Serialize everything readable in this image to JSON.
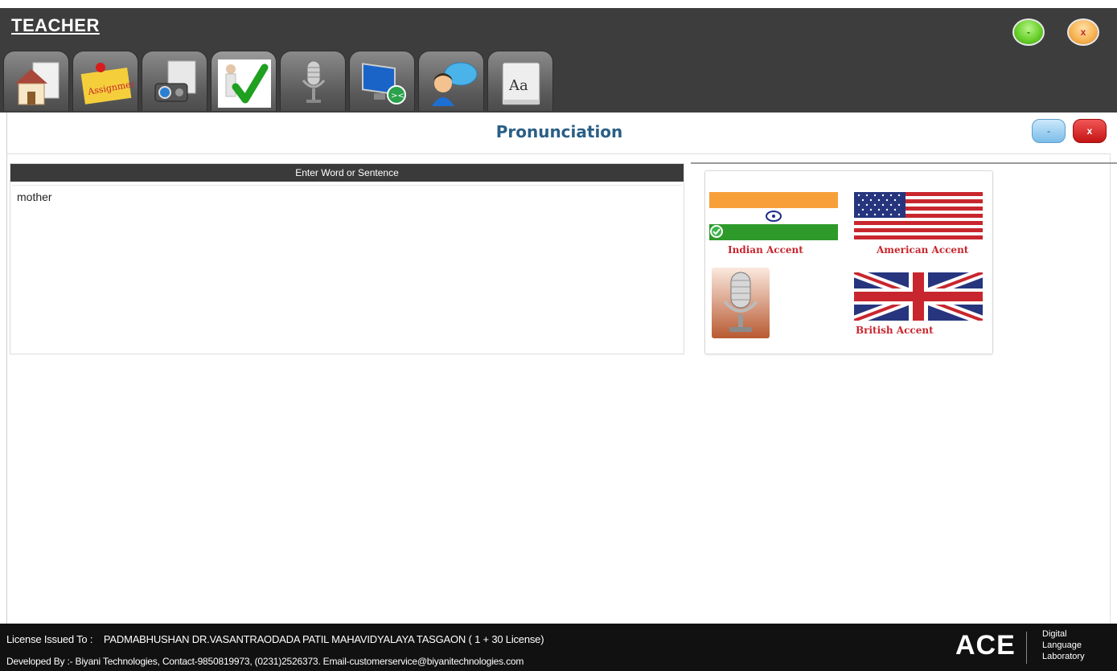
{
  "app": {
    "title": "TEACHER",
    "window_min_label": "-",
    "window_close_label": "x"
  },
  "tabs": [
    {
      "name": "home",
      "icon": "home-icon"
    },
    {
      "name": "assignment",
      "icon": "assignment-icon",
      "text": "Assignment"
    },
    {
      "name": "projector",
      "icon": "projector-icon"
    },
    {
      "name": "pronunciation",
      "icon": "checkmark-icon",
      "active": true
    },
    {
      "name": "microphone",
      "icon": "microphone-icon"
    },
    {
      "name": "remote-desktop",
      "icon": "monitor-icon"
    },
    {
      "name": "chat",
      "icon": "chat-icon"
    },
    {
      "name": "dictionary",
      "icon": "dictionary-icon",
      "text": "Aa"
    }
  ],
  "panel": {
    "title": "Pronunciation",
    "min_label": "-",
    "close_label": "x"
  },
  "word_entry": {
    "header": "Enter Word or Sentence",
    "value": "mother"
  },
  "accents": {
    "indian": "Indian Accent",
    "american": "American Accent",
    "british": "British Accent",
    "selected": "indian"
  },
  "footer": {
    "license_prefix": "License Issued To :",
    "license_value": "PADMABHUSHAN DR.VASANTRAODADA PATIL MAHAVIDYALAYA TASGAON ( 1 + 30 License)",
    "developer": "Developed By :- Biyani Technologies, Contact-9850819973, (0231)2526373. Email-customerservice@biyanitechnologies.com",
    "logo": "ACE",
    "logo_sub1": "Digital",
    "logo_sub2": "Language",
    "logo_sub3": "Laboratory"
  },
  "colors": {
    "header_bg": "#3d3d3d",
    "title_blue": "#2a5f86",
    "accent_red": "#c8262e",
    "footer_bg": "#111111"
  }
}
